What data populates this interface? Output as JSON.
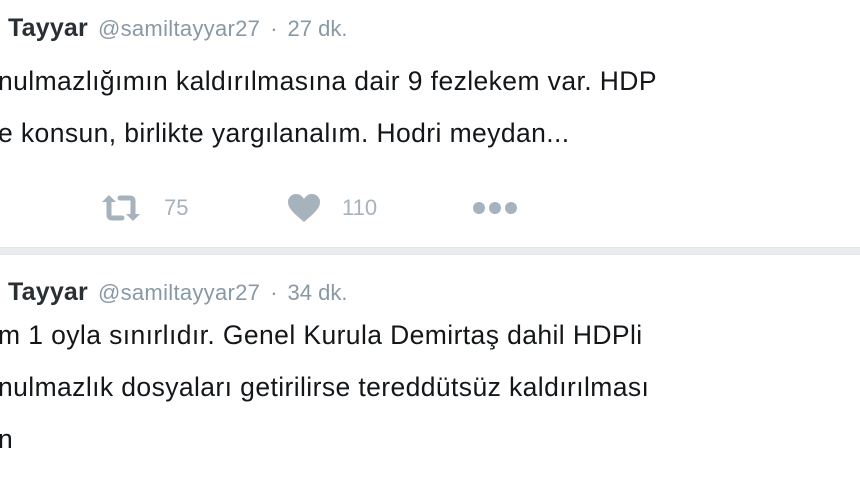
{
  "tweets": [
    {
      "name": "Tayyar",
      "handle": "@samiltayyar27",
      "separator": "·",
      "time": "27 dk.",
      "lines": [
        "nulmazlığımın kaldırılmasına dair 9 fezlekem var. HDP",
        "e konsun, birlikte yargılanalım. Hodri meydan..."
      ],
      "retweets": "75",
      "likes": "110",
      "icons": {
        "retweet": "retweet-icon",
        "like": "heart-icon",
        "more": "more-dots-icon"
      }
    },
    {
      "name": "Tayyar",
      "handle": "@samiltayyar27",
      "separator": "·",
      "time": "34 dk.",
      "lines": [
        "m 1 oyla sınırlıdır. Genel Kurula Demirtaş dahil HDPli",
        "nulmazlık dosyaları getirilirse tereddütsüz kaldırılması",
        "n"
      ]
    }
  ],
  "colors": {
    "text": "#14171a",
    "name": "#292f33",
    "muted": "#8899a6",
    "icon": "#a6b3bd",
    "divider": "#e9edf0"
  }
}
